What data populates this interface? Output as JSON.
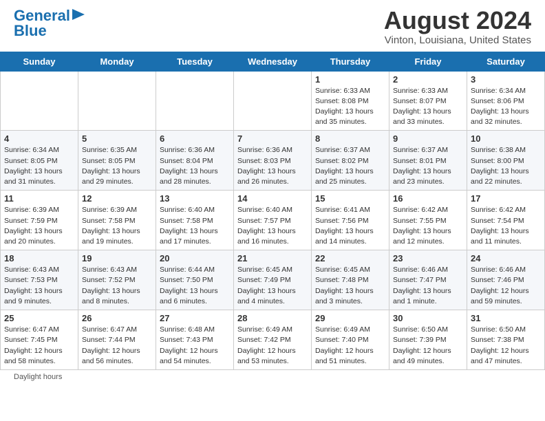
{
  "header": {
    "logo_line1": "General",
    "logo_line2": "Blue",
    "main_title": "August 2024",
    "subtitle": "Vinton, Louisiana, United States"
  },
  "calendar": {
    "days_of_week": [
      "Sunday",
      "Monday",
      "Tuesday",
      "Wednesday",
      "Thursday",
      "Friday",
      "Saturday"
    ],
    "weeks": [
      [
        {
          "num": "",
          "detail": ""
        },
        {
          "num": "",
          "detail": ""
        },
        {
          "num": "",
          "detail": ""
        },
        {
          "num": "",
          "detail": ""
        },
        {
          "num": "1",
          "detail": "Sunrise: 6:33 AM\nSunset: 8:08 PM\nDaylight: 13 hours\nand 35 minutes."
        },
        {
          "num": "2",
          "detail": "Sunrise: 6:33 AM\nSunset: 8:07 PM\nDaylight: 13 hours\nand 33 minutes."
        },
        {
          "num": "3",
          "detail": "Sunrise: 6:34 AM\nSunset: 8:06 PM\nDaylight: 13 hours\nand 32 minutes."
        }
      ],
      [
        {
          "num": "4",
          "detail": "Sunrise: 6:34 AM\nSunset: 8:05 PM\nDaylight: 13 hours\nand 31 minutes."
        },
        {
          "num": "5",
          "detail": "Sunrise: 6:35 AM\nSunset: 8:05 PM\nDaylight: 13 hours\nand 29 minutes."
        },
        {
          "num": "6",
          "detail": "Sunrise: 6:36 AM\nSunset: 8:04 PM\nDaylight: 13 hours\nand 28 minutes."
        },
        {
          "num": "7",
          "detail": "Sunrise: 6:36 AM\nSunset: 8:03 PM\nDaylight: 13 hours\nand 26 minutes."
        },
        {
          "num": "8",
          "detail": "Sunrise: 6:37 AM\nSunset: 8:02 PM\nDaylight: 13 hours\nand 25 minutes."
        },
        {
          "num": "9",
          "detail": "Sunrise: 6:37 AM\nSunset: 8:01 PM\nDaylight: 13 hours\nand 23 minutes."
        },
        {
          "num": "10",
          "detail": "Sunrise: 6:38 AM\nSunset: 8:00 PM\nDaylight: 13 hours\nand 22 minutes."
        }
      ],
      [
        {
          "num": "11",
          "detail": "Sunrise: 6:39 AM\nSunset: 7:59 PM\nDaylight: 13 hours\nand 20 minutes."
        },
        {
          "num": "12",
          "detail": "Sunrise: 6:39 AM\nSunset: 7:58 PM\nDaylight: 13 hours\nand 19 minutes."
        },
        {
          "num": "13",
          "detail": "Sunrise: 6:40 AM\nSunset: 7:58 PM\nDaylight: 13 hours\nand 17 minutes."
        },
        {
          "num": "14",
          "detail": "Sunrise: 6:40 AM\nSunset: 7:57 PM\nDaylight: 13 hours\nand 16 minutes."
        },
        {
          "num": "15",
          "detail": "Sunrise: 6:41 AM\nSunset: 7:56 PM\nDaylight: 13 hours\nand 14 minutes."
        },
        {
          "num": "16",
          "detail": "Sunrise: 6:42 AM\nSunset: 7:55 PM\nDaylight: 13 hours\nand 12 minutes."
        },
        {
          "num": "17",
          "detail": "Sunrise: 6:42 AM\nSunset: 7:54 PM\nDaylight: 13 hours\nand 11 minutes."
        }
      ],
      [
        {
          "num": "18",
          "detail": "Sunrise: 6:43 AM\nSunset: 7:53 PM\nDaylight: 13 hours\nand 9 minutes."
        },
        {
          "num": "19",
          "detail": "Sunrise: 6:43 AM\nSunset: 7:52 PM\nDaylight: 13 hours\nand 8 minutes."
        },
        {
          "num": "20",
          "detail": "Sunrise: 6:44 AM\nSunset: 7:50 PM\nDaylight: 13 hours\nand 6 minutes."
        },
        {
          "num": "21",
          "detail": "Sunrise: 6:45 AM\nSunset: 7:49 PM\nDaylight: 13 hours\nand 4 minutes."
        },
        {
          "num": "22",
          "detail": "Sunrise: 6:45 AM\nSunset: 7:48 PM\nDaylight: 13 hours\nand 3 minutes."
        },
        {
          "num": "23",
          "detail": "Sunrise: 6:46 AM\nSunset: 7:47 PM\nDaylight: 13 hours\nand 1 minute."
        },
        {
          "num": "24",
          "detail": "Sunrise: 6:46 AM\nSunset: 7:46 PM\nDaylight: 12 hours\nand 59 minutes."
        }
      ],
      [
        {
          "num": "25",
          "detail": "Sunrise: 6:47 AM\nSunset: 7:45 PM\nDaylight: 12 hours\nand 58 minutes."
        },
        {
          "num": "26",
          "detail": "Sunrise: 6:47 AM\nSunset: 7:44 PM\nDaylight: 12 hours\nand 56 minutes."
        },
        {
          "num": "27",
          "detail": "Sunrise: 6:48 AM\nSunset: 7:43 PM\nDaylight: 12 hours\nand 54 minutes."
        },
        {
          "num": "28",
          "detail": "Sunrise: 6:49 AM\nSunset: 7:42 PM\nDaylight: 12 hours\nand 53 minutes."
        },
        {
          "num": "29",
          "detail": "Sunrise: 6:49 AM\nSunset: 7:40 PM\nDaylight: 12 hours\nand 51 minutes."
        },
        {
          "num": "30",
          "detail": "Sunrise: 6:50 AM\nSunset: 7:39 PM\nDaylight: 12 hours\nand 49 minutes."
        },
        {
          "num": "31",
          "detail": "Sunrise: 6:50 AM\nSunset: 7:38 PM\nDaylight: 12 hours\nand 47 minutes."
        }
      ]
    ]
  },
  "footer": {
    "daylight_label": "Daylight hours"
  }
}
